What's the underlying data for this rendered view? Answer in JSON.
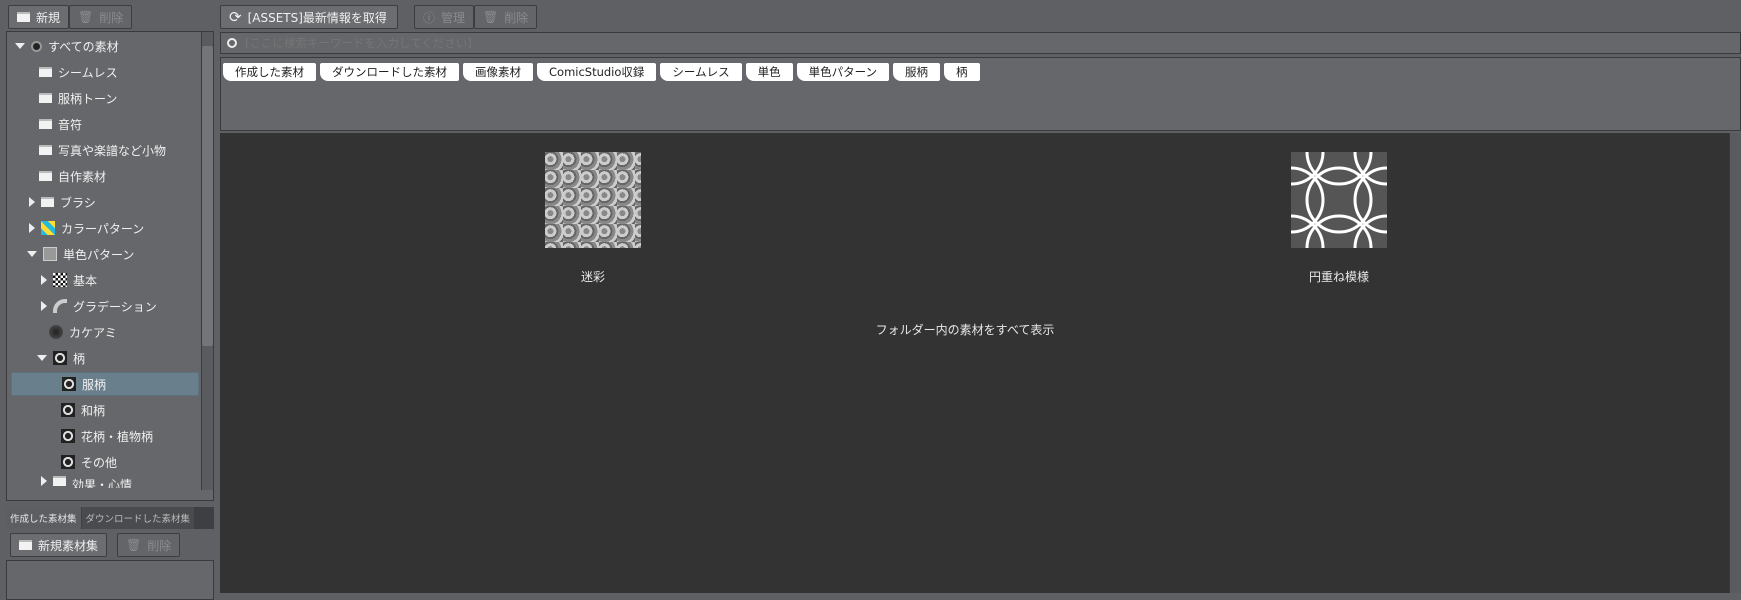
{
  "left_toolbar": {
    "new_label": "新規",
    "delete_label": "削除"
  },
  "top_toolbar": {
    "refresh_label": "[ASSETS]最新情報を取得",
    "manage_label": "管理",
    "delete_label": "削除"
  },
  "search": {
    "placeholder": "[ここに検索キーワードを入力してください]"
  },
  "tree": [
    {
      "label": "すべての素材"
    },
    {
      "label": "シームレス"
    },
    {
      "label": "服柄トーン"
    },
    {
      "label": "音符"
    },
    {
      "label": "写真や楽譜など小物"
    },
    {
      "label": "自作素材"
    },
    {
      "label": "ブラシ"
    },
    {
      "label": "カラーパターン"
    },
    {
      "label": "単色パターン"
    },
    {
      "label": "基本"
    },
    {
      "label": "グラデーション"
    },
    {
      "label": "カケアミ"
    },
    {
      "label": "柄"
    },
    {
      "label": "服柄"
    },
    {
      "label": "和柄"
    },
    {
      "label": "花柄・植物柄"
    },
    {
      "label": "その他"
    },
    {
      "label": "効果・心情"
    }
  ],
  "tags": [
    "作成した素材",
    "ダウンロードした素材",
    "画像素材",
    "ComicStudio収録",
    "シームレス",
    "単色",
    "単色パターン",
    "服柄",
    "柄"
  ],
  "collection_tabs": [
    "作成した素材集",
    "ダウンロードした素材集"
  ],
  "collection_toolbar": {
    "new_label": "新規素材集",
    "delete_label": "削除"
  },
  "materials": [
    {
      "name": "迷彩"
    },
    {
      "name": "円重ね模様"
    }
  ],
  "show_all_label": "フォルダー内の素材をすべて表示"
}
